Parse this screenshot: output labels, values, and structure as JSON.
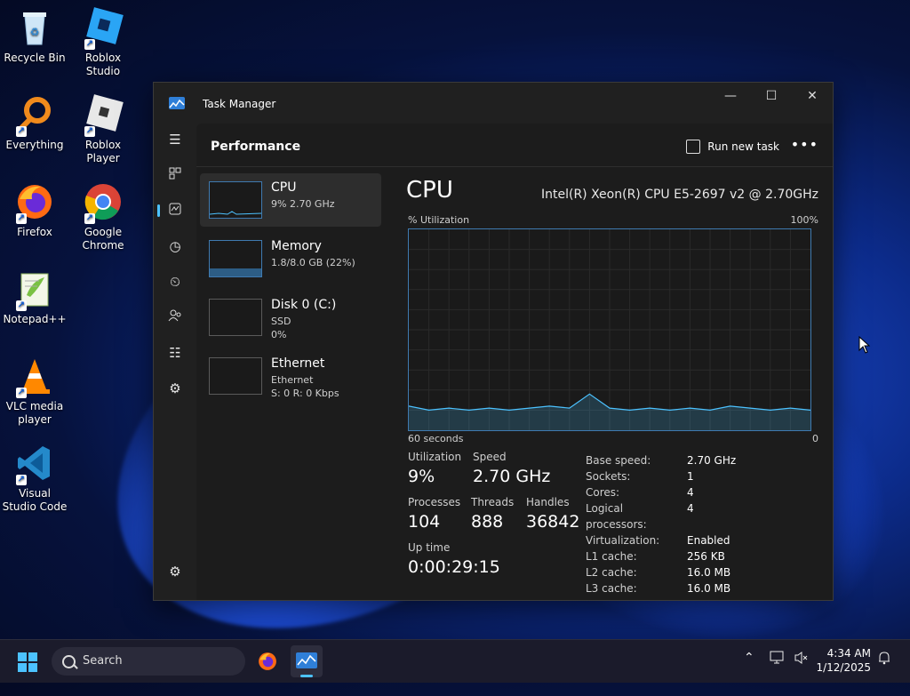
{
  "desktop": {
    "icons": [
      {
        "label": "Recycle Bin"
      },
      {
        "label": "Roblox Studio"
      },
      {
        "label": "Everything"
      },
      {
        "label": "Roblox Player"
      },
      {
        "label": "Firefox"
      },
      {
        "label": "Google Chrome"
      },
      {
        "label": "Notepad++"
      },
      {
        "label": "VLC media player"
      },
      {
        "label": "Visual Studio Code"
      }
    ]
  },
  "window": {
    "title": "Task Manager",
    "minimize": "—",
    "maximize": "☐",
    "close": "✕"
  },
  "header": {
    "title": "Performance",
    "run_new_task": "Run new task",
    "more": "•••"
  },
  "perf_list": [
    {
      "name": "CPU",
      "sub": "9% 2.70 GHz",
      "level": 0.09
    },
    {
      "name": "Memory",
      "sub": "1.8/8.0 GB (22%)",
      "level": 0.22
    },
    {
      "name": "Disk 0 (C:)",
      "sub1": "SSD",
      "sub2": "0%"
    },
    {
      "name": "Ethernet",
      "sub1": "Ethernet",
      "sub2": "S: 0 R: 0 Kbps"
    }
  ],
  "cpu": {
    "title": "CPU",
    "model": "Intel(R) Xeon(R) CPU E5-2697 v2 @ 2.70GHz",
    "util_label": "% Utilization",
    "util_max": "100%",
    "time_left": "60 seconds",
    "time_right": "0",
    "utilization_label": "Utilization",
    "utilization": "9%",
    "speed_label": "Speed",
    "speed": "2.70 GHz",
    "processes_label": "Processes",
    "processes": "104",
    "threads_label": "Threads",
    "threads": "888",
    "handles_label": "Handles",
    "handles": "36842",
    "uptime_label": "Up time",
    "uptime": "0:00:29:15",
    "details": [
      {
        "k": "Base speed:",
        "v": "2.70 GHz"
      },
      {
        "k": "Sockets:",
        "v": "1"
      },
      {
        "k": "Cores:",
        "v": "4"
      },
      {
        "k": "Logical processors:",
        "v": "4"
      },
      {
        "k": "Virtualization:",
        "v": "Enabled"
      },
      {
        "k": "L1 cache:",
        "v": "256 KB"
      },
      {
        "k": "L2 cache:",
        "v": "16.0 MB"
      },
      {
        "k": "L3 cache:",
        "v": "16.0 MB"
      }
    ]
  },
  "chart_data": {
    "type": "area",
    "x": [
      60,
      57,
      54,
      51,
      48,
      45,
      42,
      39,
      36,
      33,
      30,
      27,
      24,
      21,
      18,
      15,
      12,
      9,
      6,
      3,
      0
    ],
    "values": [
      12,
      10,
      11,
      10,
      11,
      10,
      11,
      12,
      11,
      18,
      11,
      10,
      11,
      10,
      11,
      10,
      12,
      11,
      10,
      11,
      10
    ],
    "ylim": [
      0,
      100
    ],
    "grid": true,
    "color": "#4cc2ff"
  },
  "taskbar": {
    "search_placeholder": "Search",
    "time": "4:34 AM",
    "date": "1/12/2025"
  }
}
